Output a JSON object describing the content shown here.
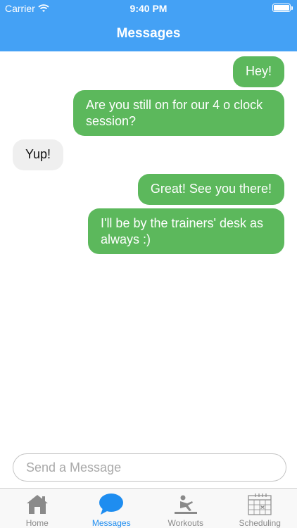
{
  "status_bar": {
    "carrier": "Carrier",
    "time": "9:40 PM"
  },
  "nav": {
    "title": "Messages"
  },
  "messages": [
    {
      "from": "me",
      "text": "Hey!"
    },
    {
      "from": "me",
      "text": "Are you still on for our 4 o clock session?"
    },
    {
      "from": "them",
      "text": "Yup!"
    },
    {
      "from": "me",
      "text": "Great! See you there!"
    },
    {
      "from": "me",
      "text": "I'll be by the trainers' desk as always :)"
    }
  ],
  "composer": {
    "placeholder": "Send a Message",
    "value": ""
  },
  "tabs": [
    {
      "label": "Home",
      "icon": "home-icon",
      "active": false
    },
    {
      "label": "Messages",
      "icon": "chat-bubble-icon",
      "active": true
    },
    {
      "label": "Workouts",
      "icon": "workout-icon",
      "active": false
    },
    {
      "label": "Scheduling",
      "icon": "calendar-icon",
      "active": false
    }
  ],
  "colors": {
    "nav_bar": "#44a1f5",
    "outgoing_bubble": "#5cb85c",
    "incoming_bubble": "#efefef",
    "active_tab": "#1e8df0",
    "inactive_tab": "#8a8a8a"
  }
}
